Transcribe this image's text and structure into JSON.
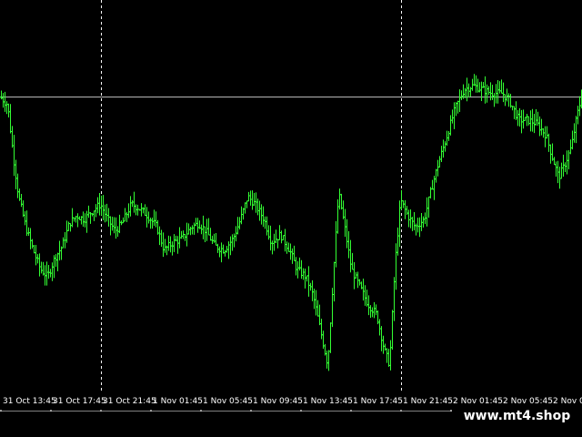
{
  "chart_data": {
    "type": "line",
    "style": "ohlc-bars",
    "series_color": "#33ff33",
    "background": "#000000",
    "grid": false,
    "x_tick_labels": [
      "31 Oct 13:45",
      "31 Oct 17:45",
      "31 Oct 21:45",
      "1 Nov 01:45",
      "1 Nov 05:45",
      "1 Nov 09:45",
      "1 Nov 13:45",
      "1 Nov 17:45",
      "1 Nov 21:45",
      "2 Nov 01:45",
      "2 Nov 05:45",
      "2 Nov 0"
    ],
    "vertical_separator_labels": [
      "31 Oct 21:45",
      "1 Nov 21:45"
    ],
    "horizontal_level_relative": 0.77,
    "y_relative_range": [
      0,
      1
    ],
    "path": [
      [
        0,
        0.77
      ],
      [
        8,
        0.75
      ],
      [
        14,
        0.62
      ],
      [
        20,
        0.51
      ],
      [
        28,
        0.43
      ],
      [
        36,
        0.37
      ],
      [
        44,
        0.32
      ],
      [
        52,
        0.3
      ],
      [
        60,
        0.35
      ],
      [
        68,
        0.38
      ],
      [
        76,
        0.44
      ],
      [
        84,
        0.46
      ],
      [
        92,
        0.45
      ],
      [
        100,
        0.47
      ],
      [
        110,
        0.49
      ],
      [
        118,
        0.45
      ],
      [
        126,
        0.42
      ],
      [
        134,
        0.44
      ],
      [
        144,
        0.49
      ],
      [
        152,
        0.48
      ],
      [
        162,
        0.46
      ],
      [
        172,
        0.43
      ],
      [
        180,
        0.37
      ],
      [
        190,
        0.39
      ],
      [
        200,
        0.4
      ],
      [
        210,
        0.43
      ],
      [
        218,
        0.44
      ],
      [
        226,
        0.42
      ],
      [
        236,
        0.38
      ],
      [
        246,
        0.37
      ],
      [
        256,
        0.4
      ],
      [
        264,
        0.45
      ],
      [
        272,
        0.51
      ],
      [
        280,
        0.49
      ],
      [
        290,
        0.45
      ],
      [
        298,
        0.39
      ],
      [
        308,
        0.41
      ],
      [
        318,
        0.37
      ],
      [
        326,
        0.32
      ],
      [
        336,
        0.3
      ],
      [
        344,
        0.25
      ],
      [
        352,
        0.16
      ],
      [
        360,
        0.07
      ],
      [
        366,
        0.3
      ],
      [
        372,
        0.52
      ],
      [
        378,
        0.44
      ],
      [
        386,
        0.32
      ],
      [
        394,
        0.28
      ],
      [
        404,
        0.23
      ],
      [
        414,
        0.2
      ],
      [
        422,
        0.11
      ],
      [
        428,
        0.07
      ],
      [
        434,
        0.33
      ],
      [
        440,
        0.5
      ],
      [
        448,
        0.46
      ],
      [
        456,
        0.43
      ],
      [
        466,
        0.45
      ],
      [
        474,
        0.53
      ],
      [
        482,
        0.6
      ],
      [
        490,
        0.66
      ],
      [
        500,
        0.74
      ],
      [
        510,
        0.79
      ],
      [
        520,
        0.8
      ],
      [
        530,
        0.79
      ],
      [
        540,
        0.78
      ],
      [
        552,
        0.78
      ],
      [
        560,
        0.76
      ],
      [
        570,
        0.71
      ],
      [
        580,
        0.71
      ],
      [
        590,
        0.7
      ],
      [
        600,
        0.67
      ],
      [
        606,
        0.62
      ],
      [
        614,
        0.56
      ],
      [
        620,
        0.59
      ],
      [
        628,
        0.64
      ],
      [
        634,
        0.72
      ],
      [
        640,
        0.78
      ]
    ]
  },
  "watermark": {
    "text": "www.mt4.shop"
  }
}
